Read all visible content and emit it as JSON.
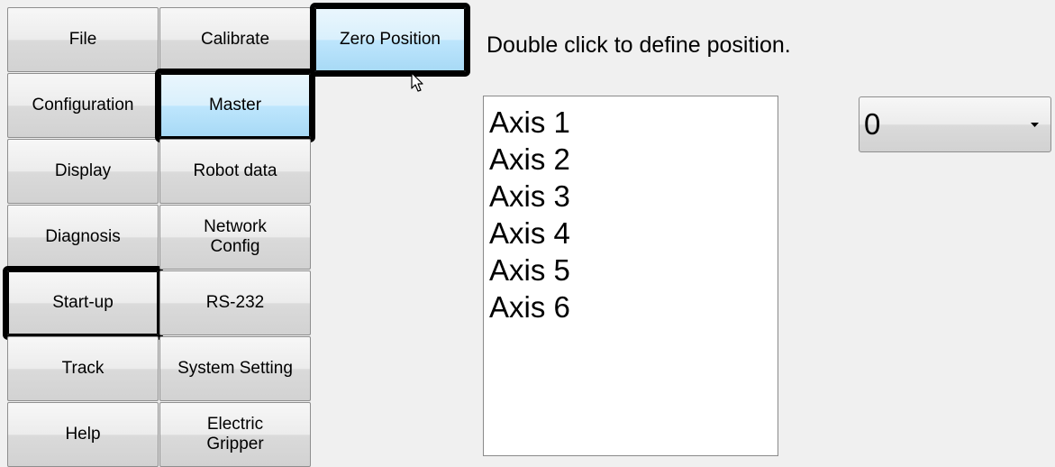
{
  "menu": {
    "col1": [
      {
        "id": "file",
        "label": "File"
      },
      {
        "id": "configuration",
        "label": "Configuration"
      },
      {
        "id": "display",
        "label": "Display"
      },
      {
        "id": "diagnosis",
        "label": "Diagnosis"
      },
      {
        "id": "start-up",
        "label": "Start-up"
      },
      {
        "id": "track",
        "label": "Track"
      },
      {
        "id": "help",
        "label": "Help"
      }
    ],
    "col2": [
      {
        "id": "calibrate",
        "label": "Calibrate"
      },
      {
        "id": "master",
        "label": "Master"
      },
      {
        "id": "robot-data",
        "label": "Robot data"
      },
      {
        "id": "network-config",
        "label": "Network\nConfig"
      },
      {
        "id": "rs-232",
        "label": "RS-232"
      },
      {
        "id": "system-setting",
        "label": "System Setting"
      },
      {
        "id": "electric-gripper",
        "label": "Electric\nGripper"
      }
    ],
    "col3": [
      {
        "id": "zero-position",
        "label": "Zero Position"
      }
    ]
  },
  "hint": "Double click to define position.",
  "axes": [
    "Axis 1",
    "Axis 2",
    "Axis 3",
    "Axis 4",
    "Axis 5",
    "Axis 6"
  ],
  "dropdown": {
    "value": "0"
  },
  "cursor_icon": "mouse-pointer-icon",
  "arrow_icon": "chevron-down-icon"
}
